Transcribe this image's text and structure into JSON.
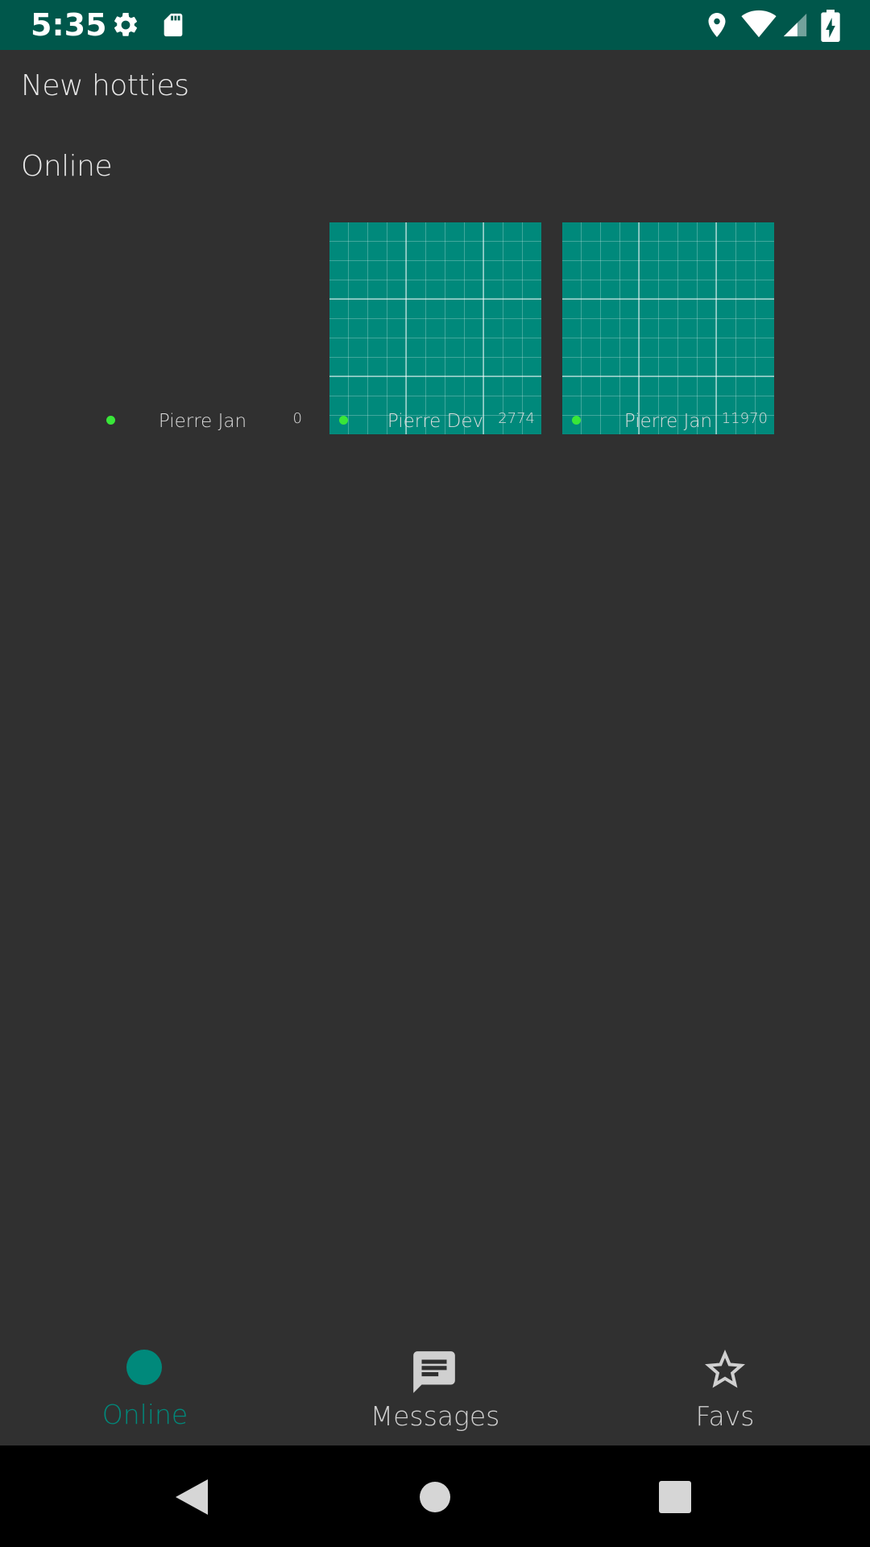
{
  "status_bar": {
    "time": "5:35",
    "icons": [
      "gear-icon",
      "sd-card-icon",
      "location-icon",
      "wifi-icon",
      "signal-icon",
      "battery-charging-icon"
    ],
    "background_color": "#00574b"
  },
  "sections": {
    "new_hotties": "New hotties",
    "online": "Online"
  },
  "online_users": [
    {
      "name": "Pierre Jan",
      "count": "0",
      "online": true,
      "has_photo": false
    },
    {
      "name": "Pierre Dev",
      "count": "2774",
      "online": true,
      "has_photo": true
    },
    {
      "name": "Pierre Jan",
      "count": "11970",
      "online": true,
      "has_photo": true
    }
  ],
  "bottom_nav": {
    "items": [
      {
        "label": "Online",
        "icon": "online-dot-icon",
        "active": true
      },
      {
        "label": "Messages",
        "icon": "message-icon",
        "active": false
      },
      {
        "label": "Favs",
        "icon": "star-icon",
        "active": false
      }
    ],
    "accent_color": "#00897b"
  },
  "system_nav": {
    "icons": [
      "back-icon",
      "home-icon",
      "recents-icon"
    ]
  }
}
